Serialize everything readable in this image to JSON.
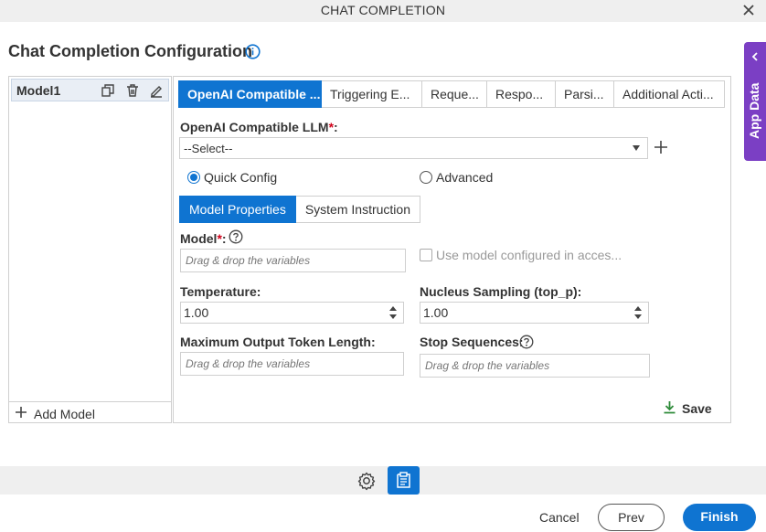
{
  "window": {
    "title": "CHAT COMPLETION"
  },
  "page": {
    "heading": "Chat Completion Configuration"
  },
  "side_tab": {
    "label": "App Data"
  },
  "models": {
    "items": [
      {
        "label": "Model1"
      }
    ],
    "add_label": "Add Model"
  },
  "tabs": [
    {
      "label": "OpenAI Compatible ..."
    },
    {
      "label": "Triggering E..."
    },
    {
      "label": "Reque..."
    },
    {
      "label": "Respo..."
    },
    {
      "label": "Parsi..."
    },
    {
      "label": "Additional Acti..."
    }
  ],
  "llm": {
    "label": "OpenAI Compatible LLM",
    "required_mark": "*",
    "value": "--Select--"
  },
  "config_mode": {
    "quick_label": "Quick Config",
    "advanced_label": "Advanced",
    "selected": "quick"
  },
  "subtabs": [
    {
      "label": "Model Properties"
    },
    {
      "label": "System Instruction"
    }
  ],
  "fields": {
    "model_label": "Model",
    "model_required": "*",
    "model_placeholder": "Drag & drop the variables",
    "use_model_label": "Use model configured in acces...",
    "temperature_label": "Temperature:",
    "temperature_value": "1.00",
    "top_p_label": "Nucleus Sampling (top_p):",
    "top_p_value": "1.00",
    "max_tokens_label": "Maximum Output Token Length:",
    "max_tokens_placeholder": "Drag & drop the variables",
    "stop_label": "Stop Sequences:",
    "stop_placeholder": "Drag & drop the variables"
  },
  "save_label": "Save",
  "footer": {
    "cancel": "Cancel",
    "prev": "Prev",
    "finish": "Finish"
  },
  "colors": {
    "primary": "#0f74d1",
    "app_data": "#7b3fc4",
    "required": "#d0021b",
    "save_icon": "#2e8b3a"
  }
}
